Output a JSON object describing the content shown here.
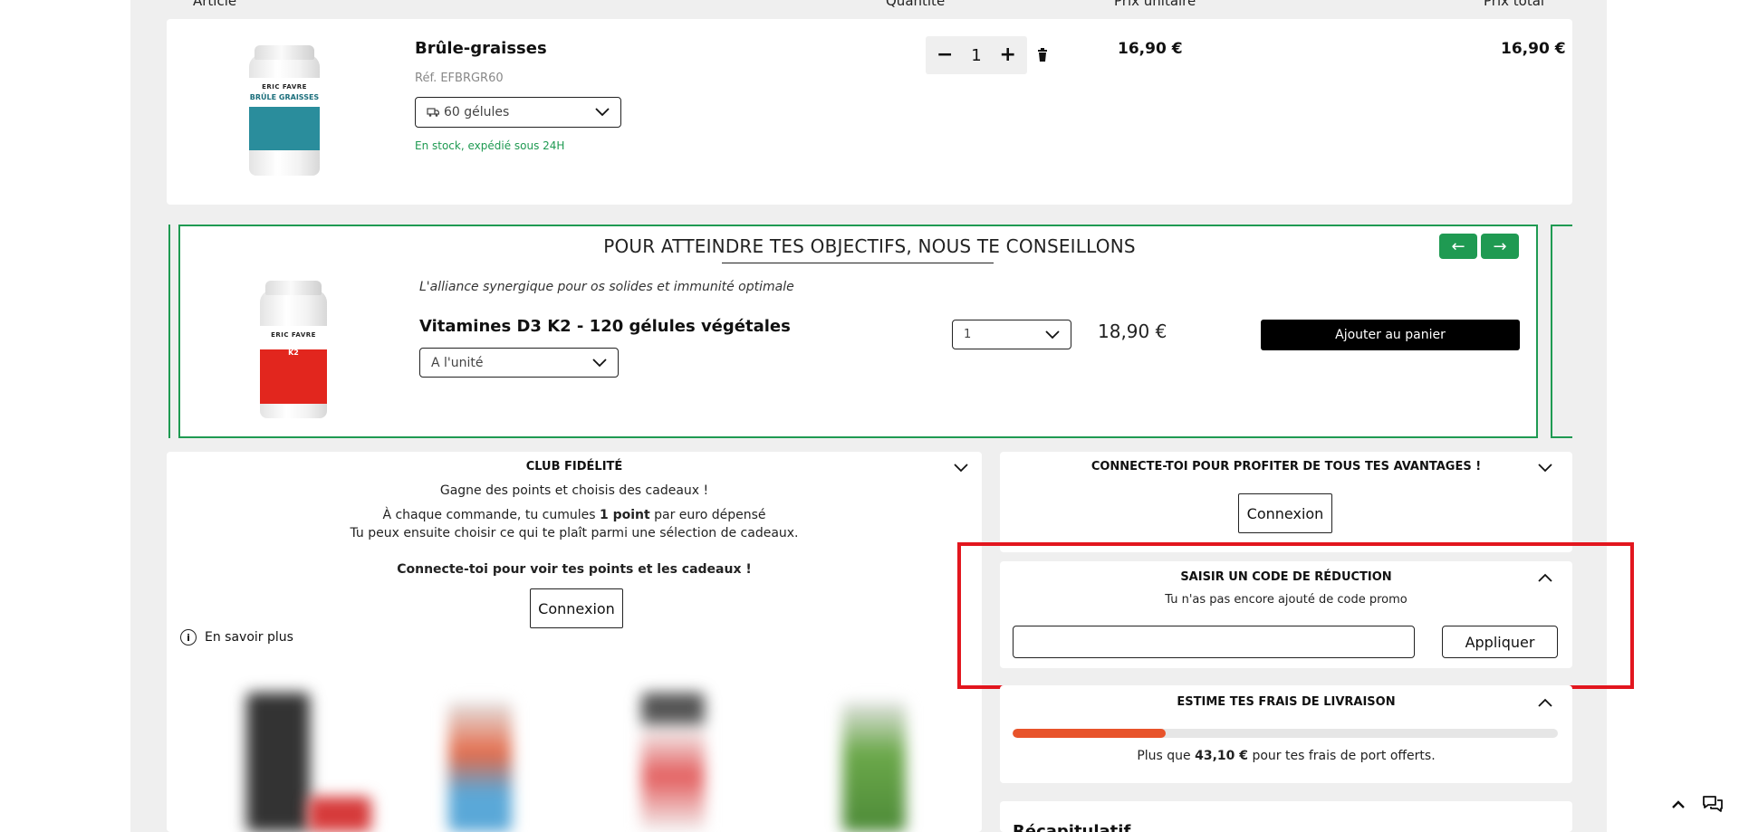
{
  "cart": {
    "columns": [
      "Article",
      "Quantité",
      "Prix unitaire",
      "Prix total"
    ],
    "item": {
      "title": "Brûle-graisses",
      "ref": "Réf. EFBRGR60",
      "variant": "60 gélules",
      "stock": "En stock, expédié sous 24H",
      "qty_minus": "−",
      "qty": "1",
      "qty_plus": "+",
      "unit_price": "16,90 €",
      "total_price": "16,90 €",
      "image": {
        "brand": "ERIC FAVRE",
        "name": "BRÛLE GRAISSES"
      }
    }
  },
  "reco": {
    "title": "POUR ATTEINDRE TES OBJECTIFS, NOUS TE CONSEILLONS",
    "prev": "←",
    "next": "→",
    "tagline": "L'alliance synergique pour os solides et immunité optimale",
    "name": "Vitamines D3 K2 - 120 gélules végétales",
    "variant": "A l'unité",
    "qty": "1",
    "price": "18,90 €",
    "add_button": "Ajouter au panier",
    "image": {
      "brand": "ERIC FAVRE",
      "name": "VITAMINES D3 K2"
    }
  },
  "loyalty": {
    "title": "CLUB FIDÉLITÉ",
    "line1": "Gagne des points et choisis des cadeaux !",
    "line2_a": "À chaque commande, tu cumules ",
    "line2_b": "1 point",
    "line2_c": " par euro dépensé",
    "line3": "Tu peux ensuite choisir ce qui te plaît parmi une sélection de cadeaux.",
    "cta": "Connecte-toi pour voir tes points et les cadeaux !",
    "button": "Connexion",
    "more": "En savoir plus"
  },
  "account": {
    "title": "CONNECTE-TOI POUR PROFITER DE TOUS TES AVANTAGES !",
    "button": "Connexion"
  },
  "promo": {
    "title": "SAISIR UN CODE DE RÉDUCTION",
    "subtitle": "Tu n'as pas encore ajouté de code promo",
    "input_value": "",
    "apply": "Appliquer"
  },
  "shipping": {
    "title": "ESTIME TES FRAIS DE LIVRAISON",
    "progress": 0.28,
    "text_a": "Plus que ",
    "amount": "43,10 €",
    "text_b": " pour tes frais de port offerts."
  },
  "summary": {
    "title": "Récapitulatif"
  },
  "colors": {
    "accent_green": "#1f9a52",
    "progress": "#e8532a",
    "highlight": "#e2161e"
  },
  "icons": [
    "minus-icon",
    "plus-icon",
    "trash-icon",
    "chevron-down-icon",
    "chevron-up-icon",
    "arrow-left-icon",
    "arrow-right-icon",
    "info-icon",
    "scroll-top-icon",
    "chat-icon",
    "truck-icon"
  ]
}
